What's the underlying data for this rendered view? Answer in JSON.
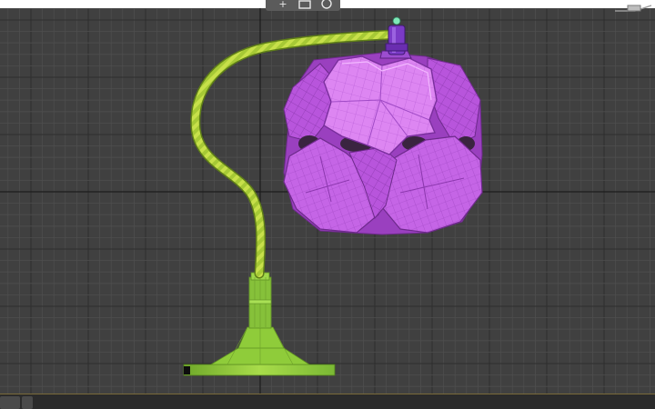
{
  "viewport": {
    "background": "#404040",
    "grid_minor": "#4e4e4e",
    "grid_major": "#2e2e2e",
    "axis_color": "#1a1a1a"
  },
  "controls": {
    "add_icon": "plus-icon",
    "maximize_icon": "maximize-icon",
    "orbit_icon": "orbit-icon"
  },
  "model": {
    "stand_color": "#8dc63f",
    "rope_color": "#b4d438",
    "shade_color": "#c05ce0",
    "shade_highlight": "#e38ef5",
    "socket_color": "#7b3ac7",
    "bulb_color": "#7fe8b8"
  }
}
